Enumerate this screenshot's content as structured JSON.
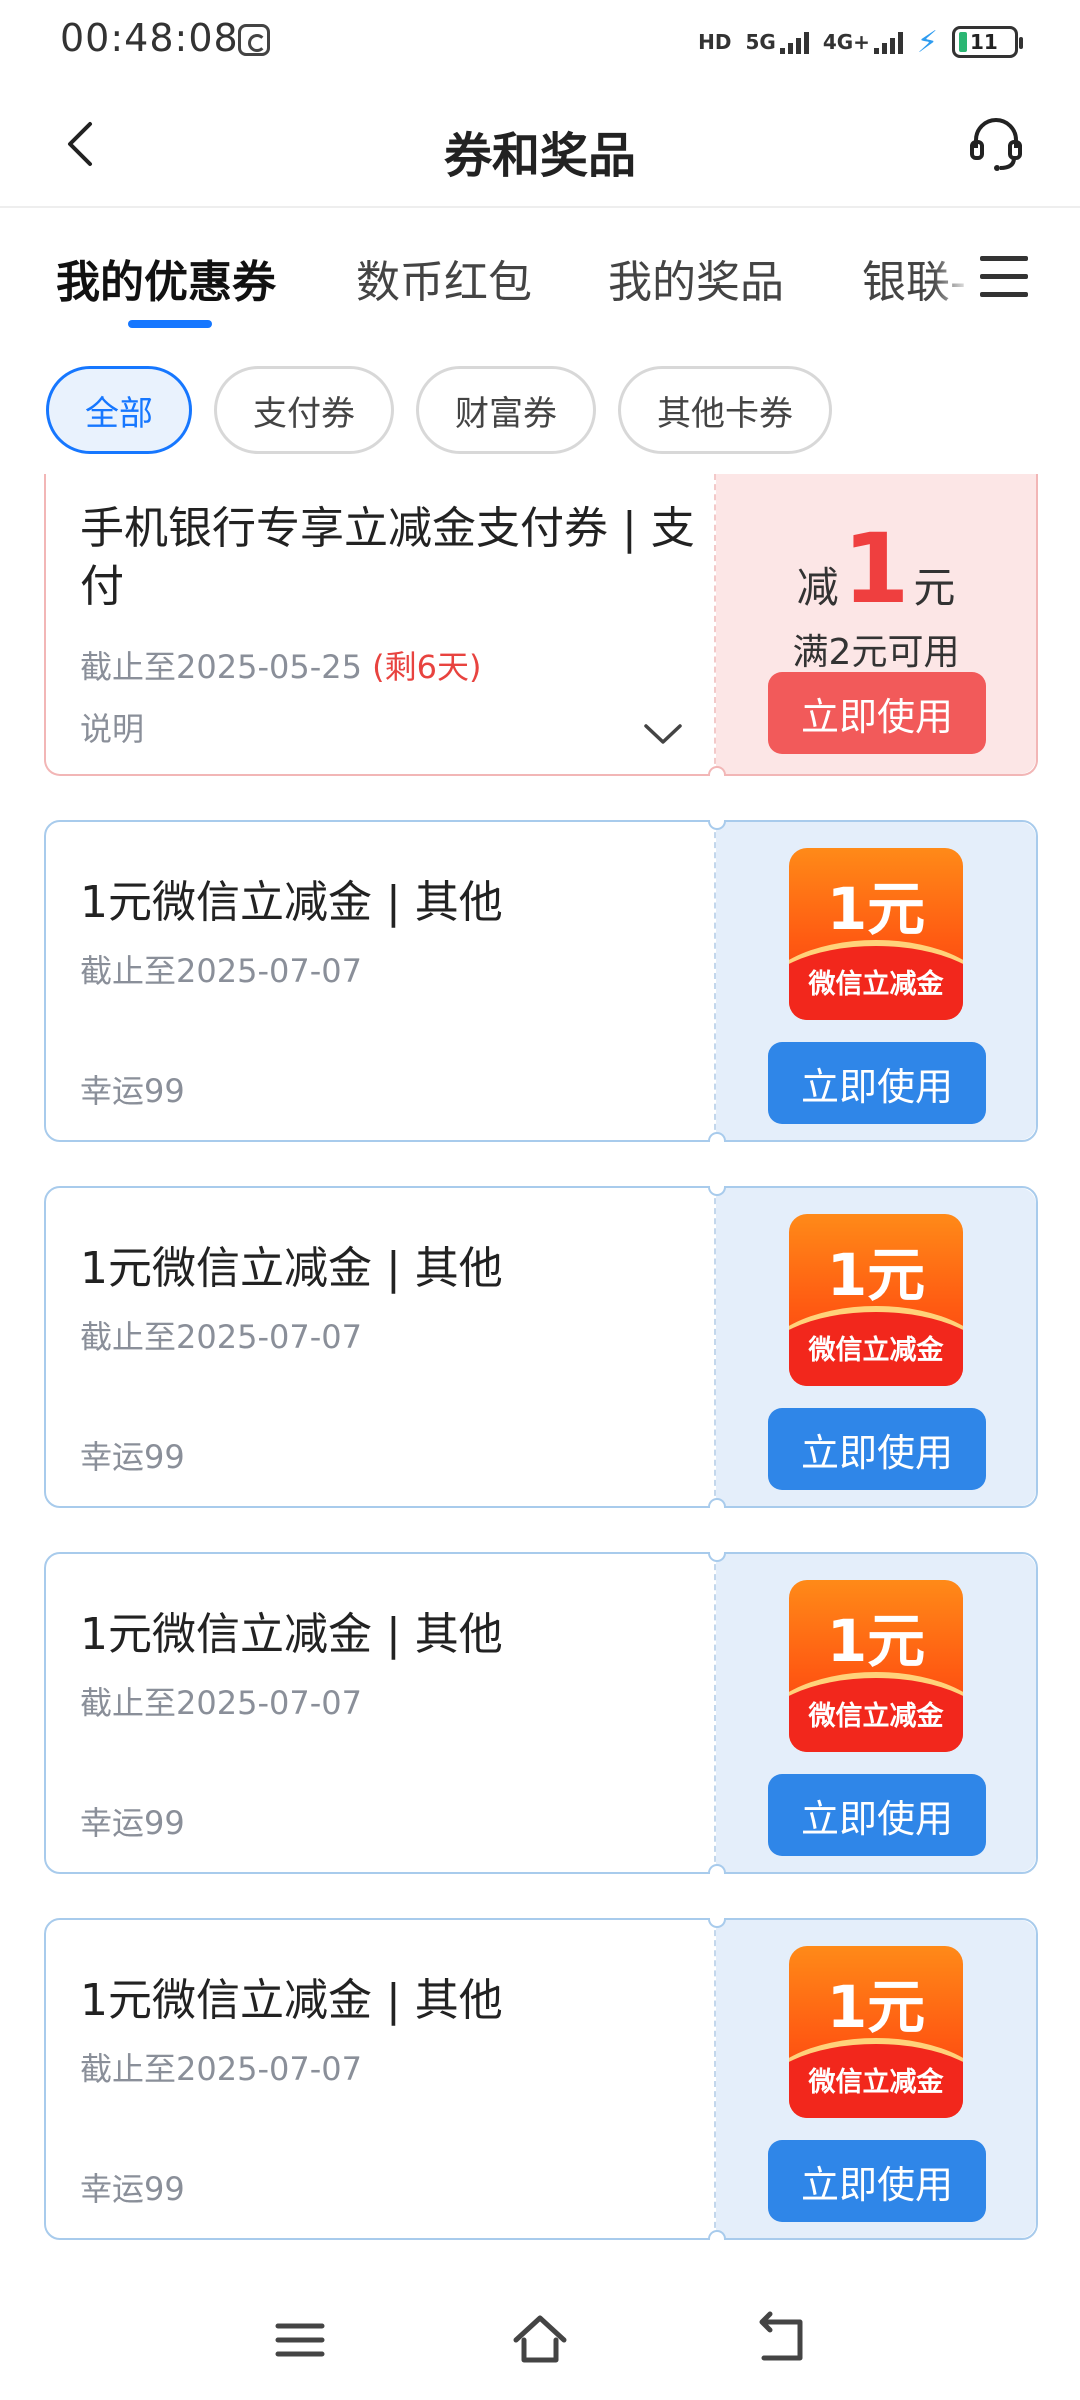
{
  "status_bar": {
    "time": "00:48:08",
    "hd_label": "HD",
    "net1": "5G",
    "net2": "4G+",
    "battery": "11"
  },
  "header": {
    "title": "券和奖品"
  },
  "tabs": [
    {
      "label": "我的优惠券",
      "active": true
    },
    {
      "label": "数币红包",
      "active": false
    },
    {
      "label": "我的奖品",
      "active": false
    },
    {
      "label": "银联-",
      "active": false
    }
  ],
  "filters": [
    {
      "label": "全部",
      "active": true
    },
    {
      "label": "支付券",
      "active": false
    },
    {
      "label": "财富券",
      "active": false
    },
    {
      "label": "其他卡券",
      "active": false
    }
  ],
  "coupons": [
    {
      "title": "手机银行专享立减金支付券 | 支付",
      "expire": "截止至2025-05-25",
      "remain": "(剩6天)",
      "note": "说明",
      "amount_prefix": "减",
      "amount": "1",
      "amount_unit": "元",
      "condition": "满2元可用",
      "button": "立即使用"
    },
    {
      "title": "1元微信立减金 | 其他",
      "expire": "截止至2025-07-07",
      "note": "幸运99",
      "badge_amount": "1元",
      "badge_label": "微信立减金",
      "button": "立即使用"
    },
    {
      "title": "1元微信立减金 | 其他",
      "expire": "截止至2025-07-07",
      "note": "幸运99",
      "badge_amount": "1元",
      "badge_label": "微信立减金",
      "button": "立即使用"
    },
    {
      "title": "1元微信立减金 | 其他",
      "expire": "截止至2025-07-07",
      "note": "幸运99",
      "badge_amount": "1元",
      "badge_label": "微信立减金",
      "button": "立即使用"
    },
    {
      "title": "1元微信立减金 | 其他",
      "expire": "截止至2025-07-07",
      "note": "幸运99",
      "badge_amount": "1元",
      "badge_label": "微信立减金",
      "button": "立即使用"
    }
  ],
  "colors": {
    "accent": "#1677ff",
    "button_blue": "#2f86e8",
    "button_red": "#f25a5a",
    "amount_red": "#ef3f3f"
  }
}
